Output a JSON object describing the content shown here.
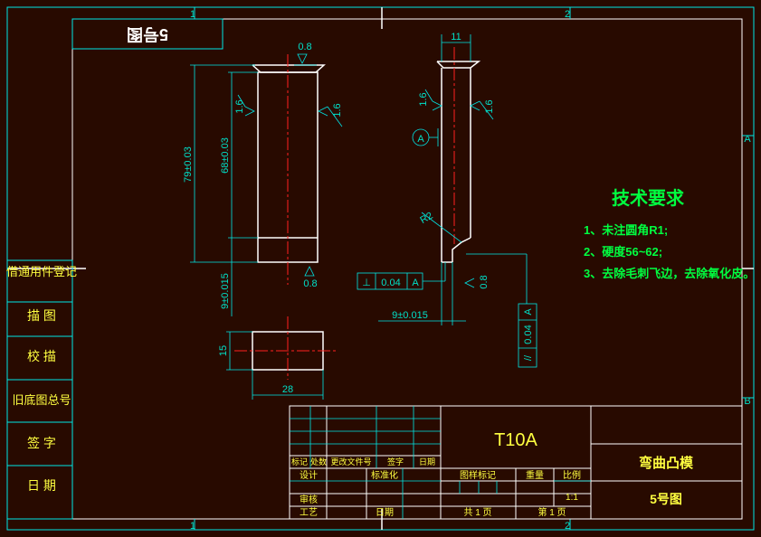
{
  "sheet": {
    "zones_top": [
      "1",
      "2"
    ],
    "zones_bottom": [
      "1",
      "2"
    ],
    "zones_right": [
      "A",
      "B"
    ],
    "mirrored_label": "5号图"
  },
  "left_column": [
    "借通用件登记",
    "描 图",
    "校 描",
    "旧底图总号",
    "签 字",
    "日 期"
  ],
  "dimensions": {
    "height_total": "79±0.03",
    "height_body": "68±0.03",
    "height_base": "9±0.015",
    "rough_top": "0.8",
    "rough_left": "1.6",
    "rough_right": "1.6",
    "rough_bottom": "0.8",
    "width_top": "11",
    "rough_side_l": "1.6",
    "rough_side_r": "1.6",
    "datum": "A",
    "radius": "R2",
    "perp_value": "0.04",
    "perp_datum": "A",
    "rough_step": "0.8",
    "step_dim": "9±0.015",
    "par_value": "0.04",
    "par_datum": "A",
    "top_view_h": "15",
    "top_view_w": "28"
  },
  "tech_req": {
    "title": "技术要求",
    "items": [
      "1、未注圆角R1;",
      "2、硬度56~62;",
      "3、去除毛刺飞边，去除氧化皮。"
    ]
  },
  "title_block": {
    "material": "T10A",
    "part_name": "弯曲凸模",
    "drawing_size": "5号图",
    "rev_headers": [
      "标记",
      "处数",
      "更改文件号",
      "签字",
      "日期"
    ],
    "design": "设计",
    "standard": "标准化",
    "review": "审核",
    "process": "工艺",
    "date": "日期",
    "stage_mark": "图样标记",
    "weight": "重量",
    "scale_label": "比例",
    "scale": "1:1",
    "total_sheets": "共 1 页",
    "sheet_no": "第 1 页"
  }
}
